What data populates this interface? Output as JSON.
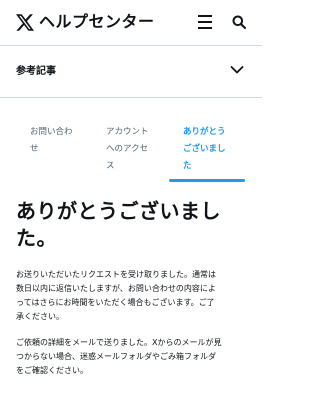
{
  "header": {
    "brand": "ヘルプセンター",
    "logo_icon": "x-logo-icon",
    "menu_icon": "hamburger-menu-icon",
    "search_icon": "search-icon"
  },
  "reference": {
    "label": "参考記事",
    "chevron_icon": "chevron-down-icon"
  },
  "tabs": [
    {
      "lines": [
        "お問い合わ",
        "せ"
      ],
      "active": false
    },
    {
      "lines": [
        "アカウント",
        "へのアクセ",
        "ス"
      ],
      "active": false
    },
    {
      "lines": [
        "ありがとう",
        "ございまし",
        "た"
      ],
      "active": true
    }
  ],
  "main": {
    "title_lines": [
      "ありがとうございまし",
      "た。"
    ],
    "paragraph1_lines": [
      "お送りいただいたリクエストを受け取りました。通常は",
      "数日以内に返信いたしますが、お問い合わせの内容によ",
      "ってはさらにお時間をいただく場合もございます。ご了",
      "承ください。"
    ],
    "paragraph2_lines": [
      "ご依頼の詳細をメールで送りました。Xからのメールが見",
      "つからない場合、迷惑メールフォルダやごみ箱フォルダ",
      "をご確認ください。"
    ]
  },
  "colors": {
    "accent": "#1d9bf0",
    "text": "#0f1419",
    "muted": "#536471",
    "divider": "#cfd9de"
  }
}
